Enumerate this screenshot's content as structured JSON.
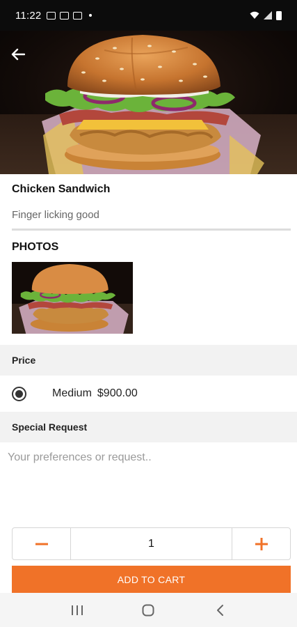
{
  "status_bar": {
    "time": "11:22"
  },
  "product": {
    "title": "Chicken Sandwich",
    "subtitle": "Finger licking good"
  },
  "photos": {
    "heading": "PHOTOS"
  },
  "price_section": {
    "heading": "Price",
    "options": [
      {
        "label": "Medium",
        "amount": "$900.00",
        "selected": true
      }
    ]
  },
  "special_request": {
    "heading": "Special Request",
    "placeholder": "Your preferences or request..",
    "value": ""
  },
  "quantity": {
    "value": "1",
    "minus_icon": "minus-icon",
    "plus_icon": "plus-icon"
  },
  "cart": {
    "button_label": "ADD TO CART"
  },
  "colors": {
    "accent": "#f07228",
    "status_bar": "#0c0c0c",
    "section_bg": "#f2f2f2"
  },
  "icons": {
    "back": "arrow-left-icon",
    "nav_recents": "recents-icon",
    "nav_home": "home-icon",
    "nav_back": "chevron-left-icon"
  }
}
